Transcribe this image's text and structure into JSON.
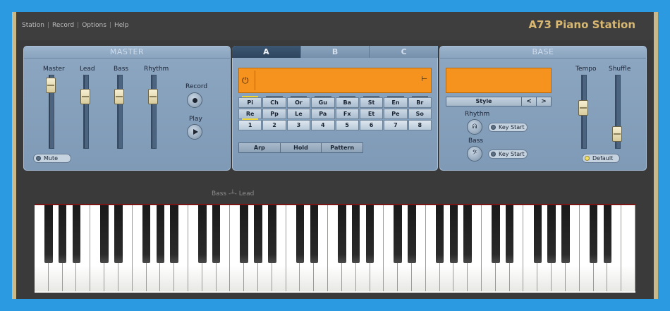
{
  "app": {
    "title": "A73 Piano Station"
  },
  "menu": [
    {
      "label": "Station"
    },
    {
      "label": "Record"
    },
    {
      "label": "Options"
    },
    {
      "label": "Help"
    }
  ],
  "master": {
    "header": "MASTER",
    "sliders": [
      {
        "label": "Master",
        "level": 0.95
      },
      {
        "label": "Lead",
        "level": 0.75
      },
      {
        "label": "Bass",
        "level": 0.75
      },
      {
        "label": "Rhythm",
        "level": 0.75
      }
    ],
    "record_label": "Record",
    "play_label": "Play",
    "mute_label": "Mute"
  },
  "center": {
    "tabs": [
      {
        "label": "A"
      },
      {
        "label": "B"
      },
      {
        "label": "C"
      }
    ],
    "active_tab": "A",
    "voices": [
      "Pi",
      "Ch",
      "Or",
      "Gu",
      "Ba",
      "St",
      "En",
      "Br"
    ],
    "variations": [
      "Re",
      "Pp",
      "Le",
      "Pa",
      "Fx",
      "Et",
      "Pe",
      "So"
    ],
    "numbers": [
      "1",
      "2",
      "3",
      "4",
      "5",
      "6",
      "7",
      "8"
    ],
    "modes": [
      {
        "label": "Arp"
      },
      {
        "label": "Hold"
      },
      {
        "label": "Pattern"
      }
    ]
  },
  "base": {
    "header": "BASE",
    "style_label": "Style",
    "prev_label": "<",
    "next_label": ">",
    "rhythm_label": "Rhythm",
    "bass_label": "Bass",
    "key_start_label": "Key Start",
    "tempo_label": "Tempo",
    "shuffle_label": "Shuffle",
    "tempo_level": 0.55,
    "shuffle_level": 0.1,
    "default_label": "Default"
  },
  "keyboard": {
    "split_label": "Bass -┴- Lead",
    "white_keys": 43
  },
  "colors": {
    "accent_orange": "#f5931e",
    "panel_blue": "#869fbb",
    "title_gold": "#d8b870",
    "frame_blue": "#2b9ae0"
  }
}
